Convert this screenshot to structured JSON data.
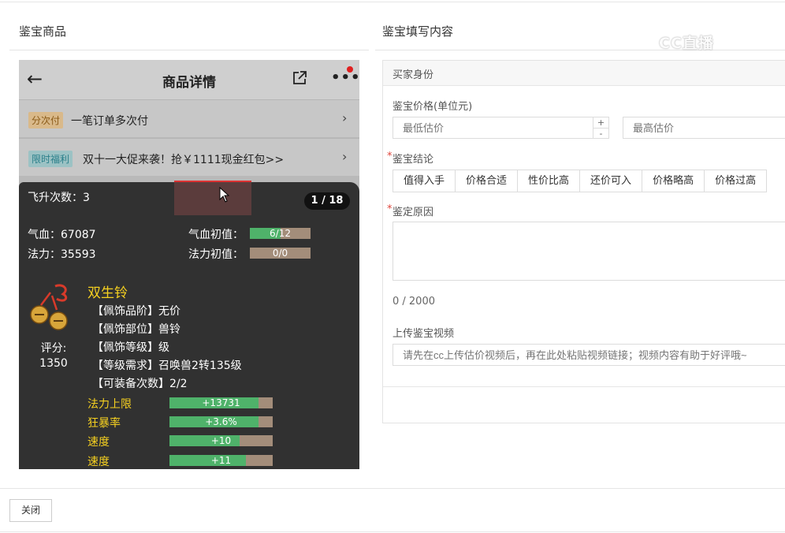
{
  "left_section": {
    "title": "鉴宝商品"
  },
  "right_section": {
    "title": "鉴宝填写内容"
  },
  "watermark": "CC直播",
  "screenshot": {
    "header_title": "商品详情",
    "row1": {
      "tag": "分次付",
      "text": "一笔订单多次付"
    },
    "row2": {
      "tag": "限时福利",
      "text": "双十一大促来袭！抢￥1111现金红包>>"
    },
    "card": {
      "ascend": "飞升次数：3",
      "pager": "1 / 18",
      "hp": "气血：67087",
      "hp_init_label": "气血初值：",
      "hp_init_value": "6/12",
      "hp_init_fraction": 0.5,
      "mp": "法力：35593",
      "mp_init_label": "法力初值：",
      "mp_init_value": "0/0",
      "mp_init_fraction": 0,
      "item_name": "双生铃",
      "attrs": [
        "【佩饰品阶】无价",
        "【佩饰部位】兽铃",
        "【佩饰等级】级",
        "【等级需求】召唤兽2转135级",
        "【可装备次数】2/2"
      ],
      "score_label": "评分:",
      "score_value": "1350",
      "stats": [
        {
          "label": "法力上限",
          "value": "+13731",
          "fill": 0.86
        },
        {
          "label": "狂暴率",
          "value": "+3.6%",
          "fill": 0.86
        },
        {
          "label": "速度",
          "value": "+10",
          "fill": 0.68
        },
        {
          "label": "速度",
          "value": "+11",
          "fill": 0.74
        }
      ]
    }
  },
  "form": {
    "header": "买家身份",
    "price_label": "鉴宝价格(单位元)",
    "min_placeholder": "最低估价",
    "max_placeholder": "最高估价",
    "conclusion_label": "鉴宝结论",
    "conclusion_options": [
      "值得入手",
      "价格合适",
      "性价比高",
      "还价可入",
      "价格略高",
      "价格过高"
    ],
    "reason_label": "鉴定原因",
    "reason_count": "0 / 2000",
    "video_label": "上传鉴宝视频",
    "video_placeholder": "请先在cc上传估价视频后，再在此处粘贴视频链接；视频内容有助于好评哦~"
  },
  "footer": {
    "close_label": "关闭"
  }
}
